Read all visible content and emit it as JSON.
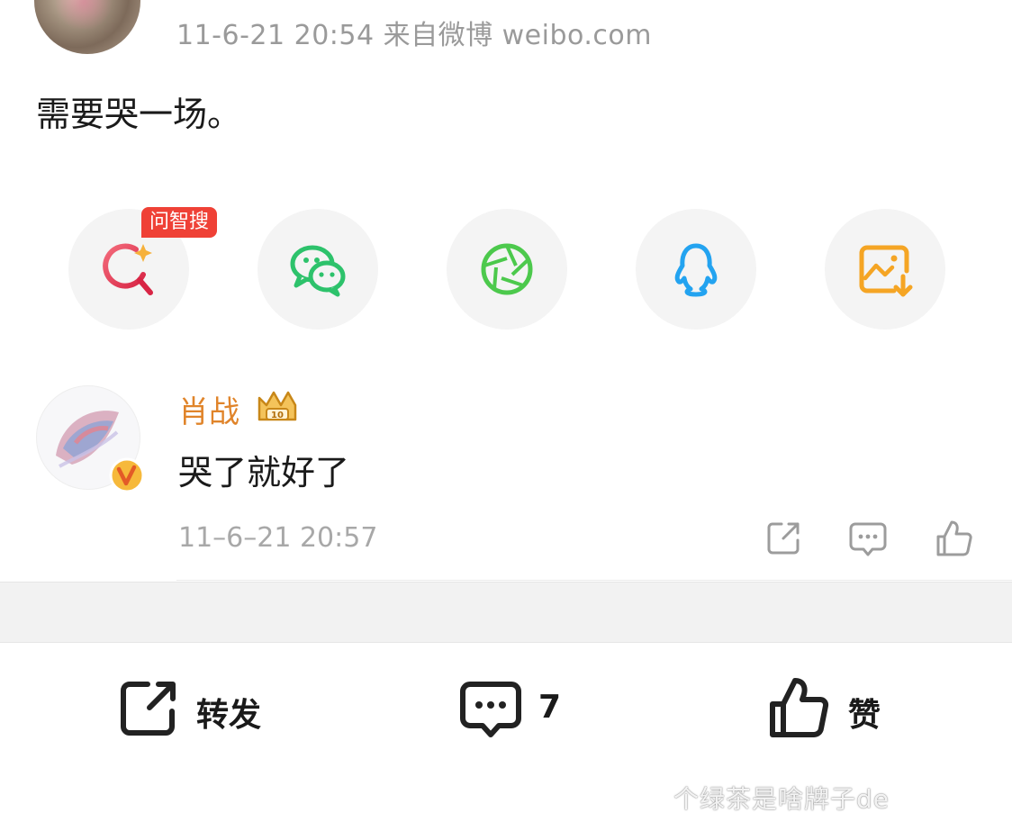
{
  "post": {
    "meta": "11-6-21 20:54  来自微博 weibo.com",
    "text": "需要哭一场。"
  },
  "share": {
    "badge": "问智搜",
    "items": [
      {
        "icon": "search-sparkle-icon",
        "color": "#e8364c"
      },
      {
        "icon": "wechat-icon",
        "color": "#2dc26b"
      },
      {
        "icon": "moments-aperture-icon",
        "color": "#4cc94c"
      },
      {
        "icon": "qq-penguin-icon",
        "color": "#23a3f0"
      },
      {
        "icon": "save-image-icon",
        "color": "#f5a524"
      }
    ]
  },
  "comment": {
    "user": "肖战",
    "text": "哭了就好了",
    "time": "11–6–21 20:57",
    "actions": [
      "repost-icon",
      "reply-icon",
      "like-icon"
    ]
  },
  "bottom_bar": {
    "repost_label": "转发",
    "comment_count": "7",
    "like_label": "赞"
  },
  "watermark": "个绿茶是啥牌子de",
  "colors": {
    "username": "#e0842a",
    "badge_red": "#ef4136",
    "meta_gray": "#9a9a9a"
  }
}
